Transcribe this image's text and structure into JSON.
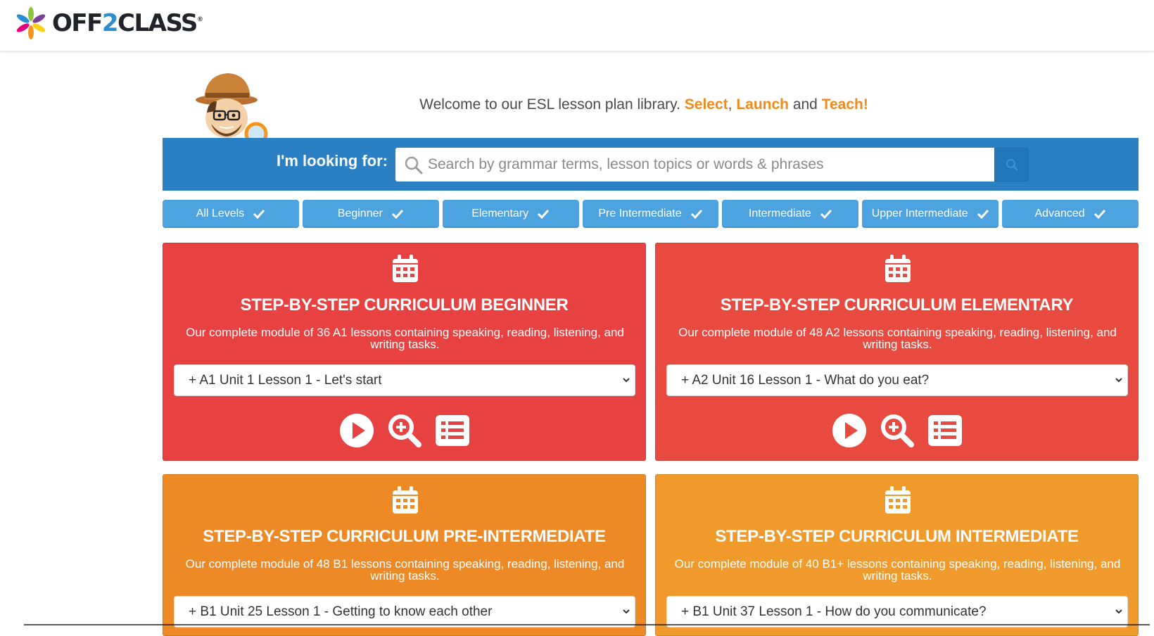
{
  "brand": {
    "name_a": "OFF",
    "name_b": "2",
    "name_c": "CLASS",
    "reg": "®"
  },
  "welcome": {
    "prefix": "Welcome to our ESL lesson plan library. ",
    "select": "Select",
    "sep1": ", ",
    "launch": "Launch",
    "sep2": " and ",
    "teach": "Teach!"
  },
  "search": {
    "label": "I'm looking for:",
    "placeholder": "Search by grammar terms, lesson topics or words & phrases",
    "icon": "search-icon",
    "button_icon": "search-icon"
  },
  "levels": [
    {
      "label": "All Levels",
      "checked": true
    },
    {
      "label": "Beginner",
      "checked": true
    },
    {
      "label": "Elementary",
      "checked": true
    },
    {
      "label": "Pre Intermediate",
      "checked": true
    },
    {
      "label": "Intermediate",
      "checked": true
    },
    {
      "label": "Upper Intermediate",
      "checked": true
    },
    {
      "label": "Advanced",
      "checked": true
    }
  ],
  "cards": [
    {
      "title": "STEP-BY-STEP CURRICULUM BEGINNER",
      "desc": "Our complete module of 36 A1 lessons containing speaking, reading, listening, and writing tasks.",
      "selected": "+ A1 Unit 1 Lesson 1 - Let's start",
      "color": "#e84141"
    },
    {
      "title": "STEP-BY-STEP CURRICULUM ELEMENTARY",
      "desc": "Our complete module of 48 A2 lessons containing speaking, reading, listening, and writing tasks.",
      "selected": "+ A2 Unit 16 Lesson 1 - What do you eat?",
      "color": "#e84a40"
    },
    {
      "title": "STEP-BY-STEP CURRICULUM PRE-INTERMEDIATE",
      "desc": "Our complete module of 48 B1 lessons containing speaking, reading, listening, and writing tasks.",
      "selected": "+ B1 Unit 25 Lesson 1 - Getting to know each other",
      "color": "#ee8a26"
    },
    {
      "title": "STEP-BY-STEP CURRICULUM INTERMEDIATE",
      "desc": "Our complete module of 40 B1+ lessons containing speaking, reading, listening, and writing tasks.",
      "selected": "+ B1 Unit 37 Lesson 1 - How do you communicate?",
      "color": "#f09a2c"
    }
  ],
  "colors": {
    "accent_blue": "#2a80c3",
    "level_blue": "#4da3e0",
    "highlight_orange": "#f08a1c"
  }
}
